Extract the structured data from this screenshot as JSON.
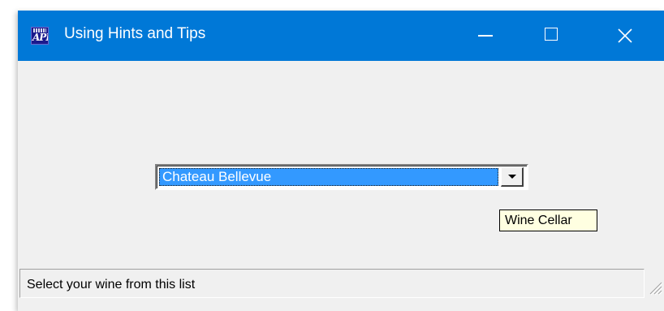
{
  "window": {
    "title": "Using Hints and Tips",
    "title_bar_color": "#0078d7",
    "app_icon": "api-app-icon",
    "app_icon_text": "API",
    "caption_buttons": {
      "minimize": "minimize-icon",
      "maximize": "maximize-icon",
      "close": "close-icon"
    }
  },
  "combo": {
    "selected_value": "Chateau Bellevue",
    "dropdown_icon": "dropdown-arrow-icon",
    "selection_color": "#3399ff"
  },
  "tooltip": {
    "text": "Wine Cellar",
    "background_color": "#ffffe1"
  },
  "statusbar": {
    "text": "Select your wine from this list",
    "grip_icon": "resize-grip-icon"
  }
}
